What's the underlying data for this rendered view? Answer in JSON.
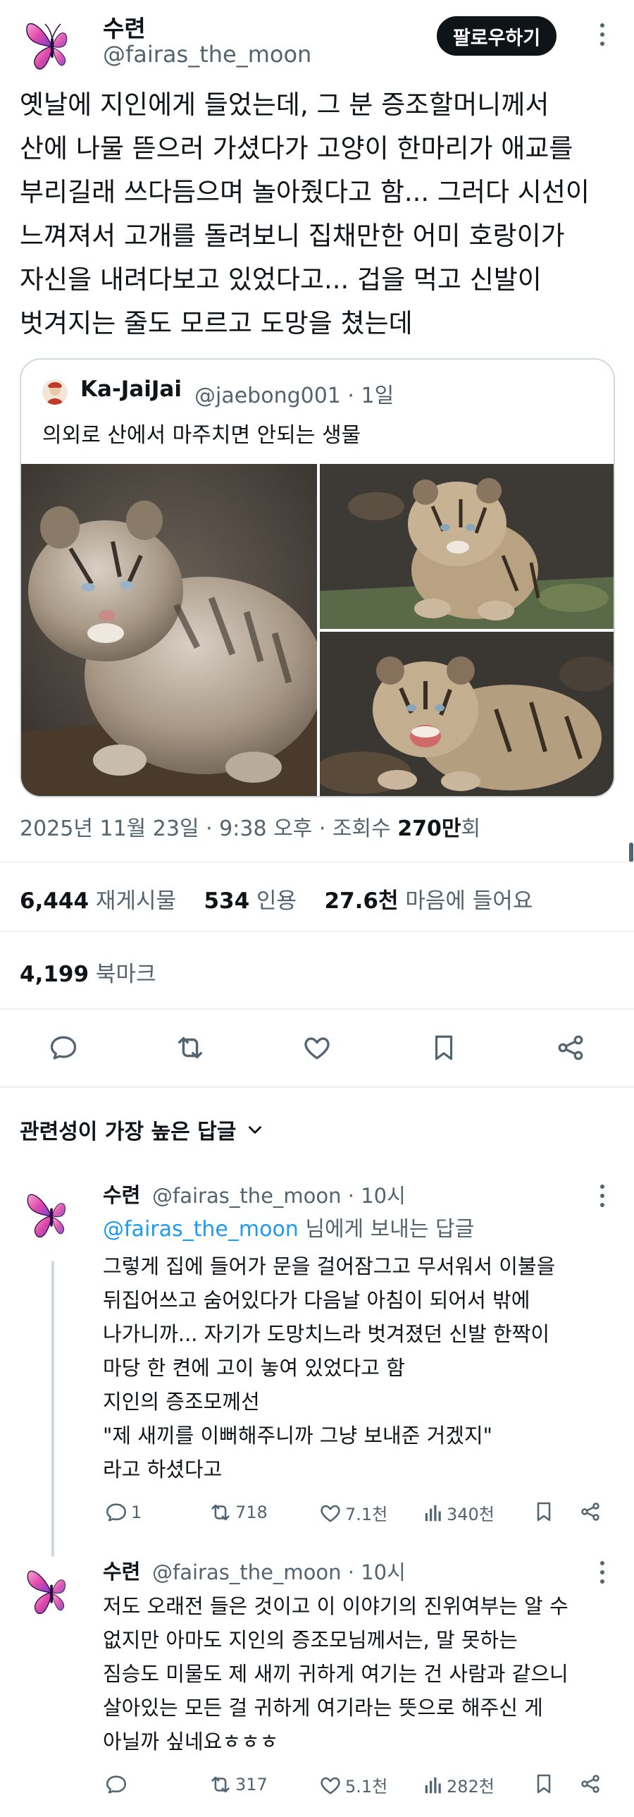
{
  "tweet": {
    "author_name": "수련",
    "author_handle": "@fairas_the_moon",
    "follow_label": "팔로우하기",
    "body_lines": [
      "옛날에 지인에게 들었는데, 그 분 증조할머니께서",
      "산에 나물 뜯으러 가셨다가 고양이 한마리가 애교를",
      "부리길래 쓰다듬으며 놀아줬다고 함... 그러다 시선이",
      "느껴져서 고개를 돌려보니 집채만한 어미 호랑이가",
      "자신을 내려다보고 있었다고... 겁을 먹고 신발이",
      "벗겨지는 줄도 모르고 도망을 쳤는데"
    ],
    "timestamp": "2025년 11월 23일 · 9:38 오후 · 조회수 ",
    "views_number": "270만",
    "views_suffix": "회"
  },
  "quote": {
    "name": "Ka-JaiJai",
    "meta": "@jaebong001 · 1일",
    "text": "의외로 산에서 마주치면 안되는 생물"
  },
  "stats": {
    "reposts_count": "6,444",
    "reposts_label": "재게시물",
    "quotes_count": "534",
    "quotes_label": "인용",
    "likes_count": "27.6천",
    "likes_label": "마음에 들어요",
    "bookmarks_count": "4,199",
    "bookmarks_label": "북마크"
  },
  "sort": {
    "label": "관련성이 가장 높은 답글"
  },
  "replies": [
    {
      "name": "수련",
      "handle_time": "@fairas_the_moon · 10시",
      "mention": "@fairas_the_moon",
      "mention_suffix": " 님에게 보내는 답글",
      "lines": [
        "그렇게 집에 들어가 문을 걸어잠그고 무서워서 이불을",
        "뒤집어쓰고 숨어있다가 다음날 아침이 되어서 밖에",
        "나가니까... 자기가 도망치느라 벗겨졌던 신발 한짝이",
        "마당 한 켠에 고이 놓여 있었다고 함",
        "지인의 증조모께선",
        "\"제 새끼를 이뻐해주니까 그냥 보내준 거겠지\"",
        "라고 하셨다고"
      ],
      "replies_count": "1",
      "reposts_count": "718",
      "likes_count": "7.1천",
      "views_count": "340천"
    },
    {
      "name": "수련",
      "handle_time": "@fairas_the_moon · 10시",
      "lines": [
        "저도 오래전 들은 것이고 이 이야기의 진위여부는 알 수",
        "없지만 아마도 지인의 증조모님께서는, 말 못하는",
        "짐승도 미물도 제 새끼 귀하게 여기는 건 사람과 같으니",
        "살아있는 모든 걸 귀하게 여기라는 뜻으로 해주신 게",
        "아닐까 싶네요ㅎㅎㅎ"
      ],
      "replies_count": "",
      "reposts_count": "317",
      "likes_count": "5.1천",
      "views_count": "282천"
    }
  ],
  "colors": {
    "text": "#0f1419",
    "muted": "#536471",
    "link": "#1d9bf0",
    "border": "#cfd9de",
    "butterfly_pink": "#e04aa8",
    "butterfly_purple": "#7a3fd6"
  },
  "icons": [
    "butterfly-avatar",
    "kebab-icon",
    "reply-icon",
    "retweet-icon",
    "like-icon",
    "bookmark-icon",
    "share-icon",
    "views-icon",
    "chevron-down-icon"
  ]
}
